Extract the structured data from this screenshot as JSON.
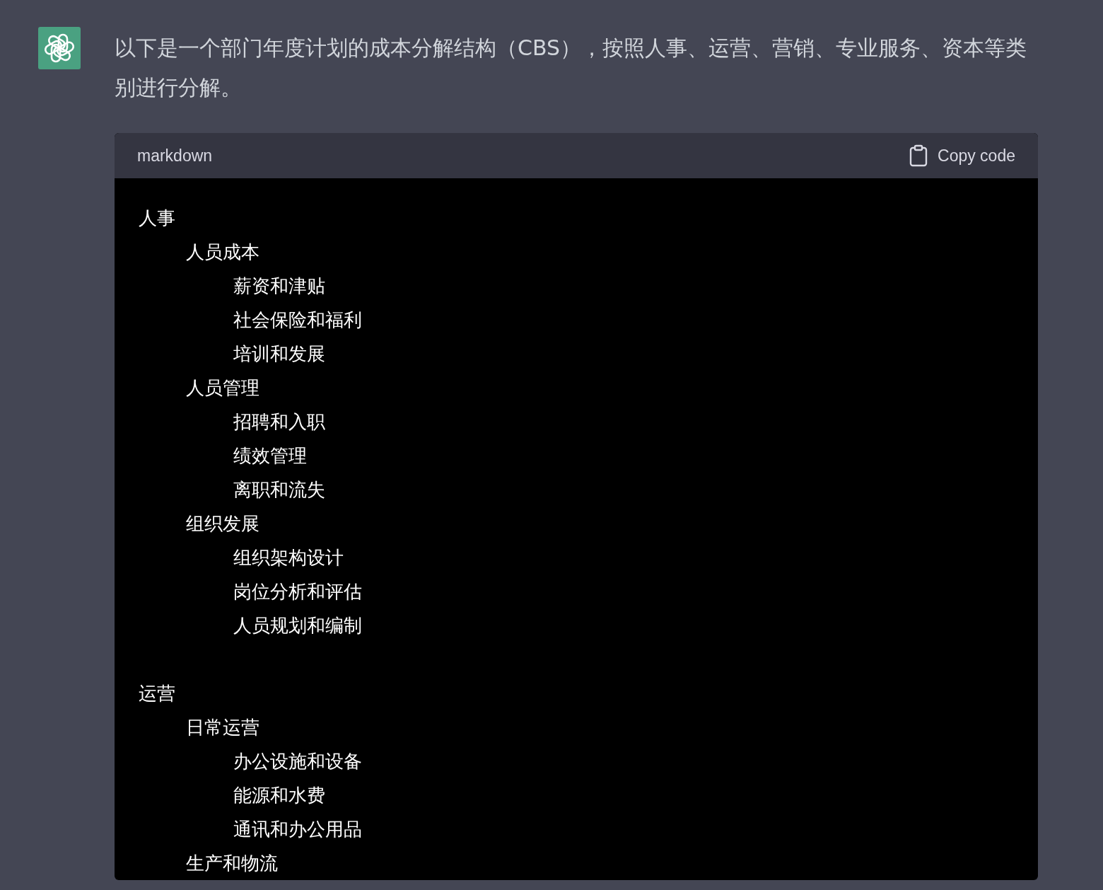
{
  "message": {
    "text": "以下是一个部门年度计划的成本分解结构（CBS），按照人事、运营、营销、专业服务、资本等类别进行分解。"
  },
  "code_block": {
    "language": "markdown",
    "copy_label": "Copy code",
    "tree": [
      {
        "label": "人事",
        "children": [
          {
            "label": "人员成本",
            "children": [
              {
                "label": "薪资和津贴"
              },
              {
                "label": "社会保险和福利"
              },
              {
                "label": "培训和发展"
              }
            ]
          },
          {
            "label": "人员管理",
            "children": [
              {
                "label": "招聘和入职"
              },
              {
                "label": "绩效管理"
              },
              {
                "label": "离职和流失"
              }
            ]
          },
          {
            "label": "组织发展",
            "children": [
              {
                "label": "组织架构设计"
              },
              {
                "label": "岗位分析和评估"
              },
              {
                "label": "人员规划和编制"
              }
            ]
          }
        ]
      },
      {
        "label": "运营",
        "children": [
          {
            "label": "日常运营",
            "children": [
              {
                "label": "办公设施和设备"
              },
              {
                "label": "能源和水费"
              },
              {
                "label": "通讯和办公用品"
              }
            ]
          },
          {
            "label": "生产和物流"
          }
        ]
      }
    ]
  }
}
